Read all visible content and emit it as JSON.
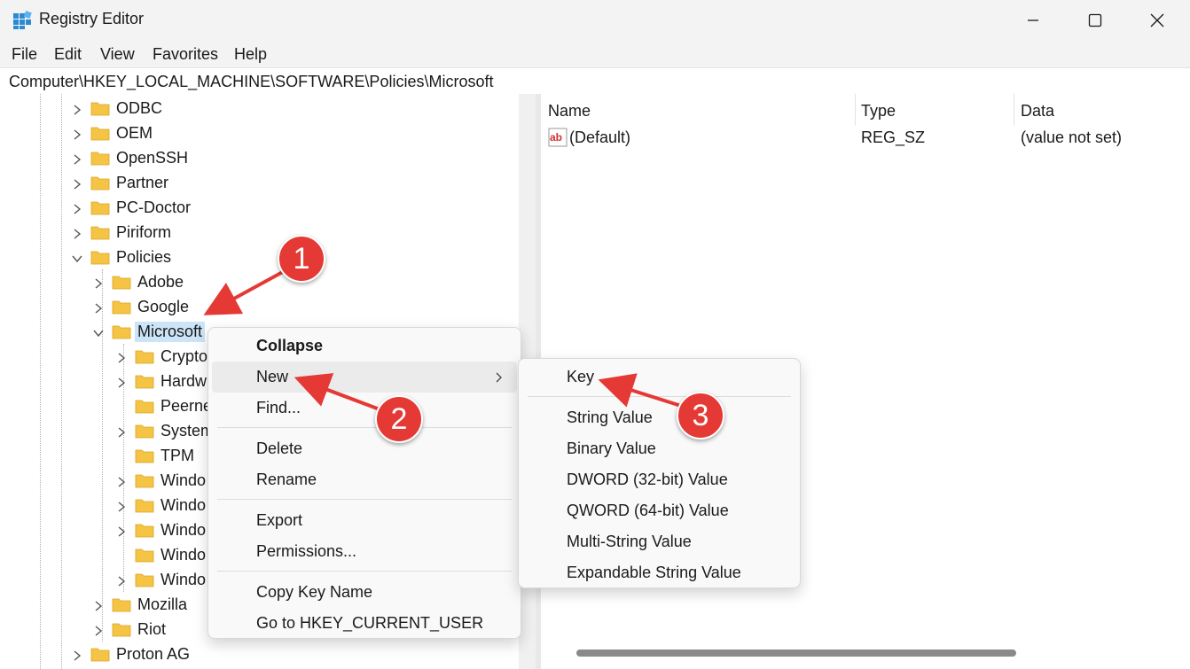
{
  "window": {
    "title": "Registry Editor"
  },
  "menu": [
    "File",
    "Edit",
    "View",
    "Favorites",
    "Help"
  ],
  "address": "Computer\\HKEY_LOCAL_MACHINE\\SOFTWARE\\Policies\\Microsoft",
  "tree": [
    {
      "label": "ODBC",
      "depth": 0,
      "expander": "collapsed"
    },
    {
      "label": "OEM",
      "depth": 0,
      "expander": "collapsed"
    },
    {
      "label": "OpenSSH",
      "depth": 0,
      "expander": "collapsed"
    },
    {
      "label": "Partner",
      "depth": 0,
      "expander": "collapsed"
    },
    {
      "label": "PC-Doctor",
      "depth": 0,
      "expander": "collapsed"
    },
    {
      "label": "Piriform",
      "depth": 0,
      "expander": "collapsed"
    },
    {
      "label": "Policies",
      "depth": 0,
      "expander": "expanded"
    },
    {
      "label": "Adobe",
      "depth": 1,
      "expander": "collapsed"
    },
    {
      "label": "Google",
      "depth": 1,
      "expander": "collapsed"
    },
    {
      "label": "Microsoft",
      "depth": 1,
      "expander": "expanded",
      "selected": true
    },
    {
      "label": "Crypto",
      "depth": 2,
      "expander": "collapsed"
    },
    {
      "label": "Hardw",
      "depth": 2,
      "expander": "collapsed"
    },
    {
      "label": "Peerne",
      "depth": 2,
      "expander": "none"
    },
    {
      "label": "System",
      "depth": 2,
      "expander": "collapsed"
    },
    {
      "label": "TPM",
      "depth": 2,
      "expander": "none"
    },
    {
      "label": "Windo",
      "depth": 2,
      "expander": "collapsed"
    },
    {
      "label": "Windo",
      "depth": 2,
      "expander": "collapsed"
    },
    {
      "label": "Windo",
      "depth": 2,
      "expander": "collapsed"
    },
    {
      "label": "Windo",
      "depth": 2,
      "expander": "none"
    },
    {
      "label": "Windo",
      "depth": 2,
      "expander": "collapsed"
    },
    {
      "label": "Mozilla",
      "depth": 1,
      "expander": "collapsed"
    },
    {
      "label": "Riot",
      "depth": 1,
      "expander": "collapsed"
    },
    {
      "label": "Proton AG",
      "depth": 0,
      "expander": "collapsed"
    }
  ],
  "list": {
    "columns": [
      "Name",
      "Type",
      "Data"
    ],
    "rows": [
      {
        "name": "(Default)",
        "type": "REG_SZ",
        "data": "(value not set)"
      }
    ]
  },
  "context_menu": {
    "groups": [
      [
        {
          "label": "Collapse",
          "bold": true
        },
        {
          "label": "New",
          "submenu": true,
          "highlighted": true
        },
        {
          "label": "Find..."
        }
      ],
      [
        {
          "label": "Delete"
        },
        {
          "label": "Rename"
        }
      ],
      [
        {
          "label": "Export"
        },
        {
          "label": "Permissions..."
        }
      ],
      [
        {
          "label": "Copy Key Name"
        },
        {
          "label": "Go to HKEY_CURRENT_USER"
        }
      ]
    ]
  },
  "submenu": {
    "groups": [
      [
        {
          "label": "Key"
        }
      ],
      [
        {
          "label": "String Value"
        },
        {
          "label": "Binary Value"
        },
        {
          "label": "DWORD (32-bit) Value"
        },
        {
          "label": "QWORD (64-bit) Value"
        },
        {
          "label": "Multi-String Value"
        },
        {
          "label": "Expandable String Value"
        }
      ]
    ]
  },
  "annotations": [
    "1",
    "2",
    "3"
  ],
  "colors": {
    "annotation": "#e53935",
    "selection": "#cce4f7",
    "folder": "#f6c445"
  }
}
